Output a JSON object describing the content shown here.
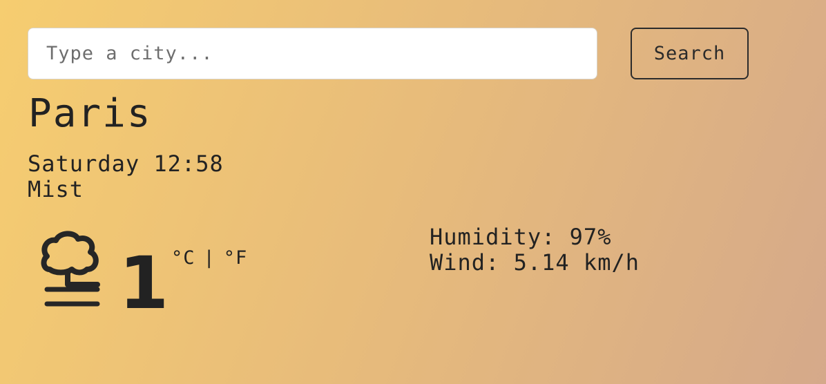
{
  "search": {
    "placeholder": "Type a city...",
    "value": "",
    "button_label": "Search"
  },
  "weather": {
    "city": "Paris",
    "datetime": "Saturday 12:58",
    "description": "Mist",
    "icon": "mist-icon",
    "temperature": "1",
    "units": {
      "celsius": "°C",
      "separator": "|",
      "fahrenheit": "°F"
    },
    "humidity_label": "Humidity:",
    "humidity_value": "97%",
    "wind_label": "Wind:",
    "wind_value": "5.14 km/h"
  },
  "colors": {
    "gradient_start": "#f6cd70",
    "gradient_end": "#d5a98a",
    "text": "#222222"
  }
}
